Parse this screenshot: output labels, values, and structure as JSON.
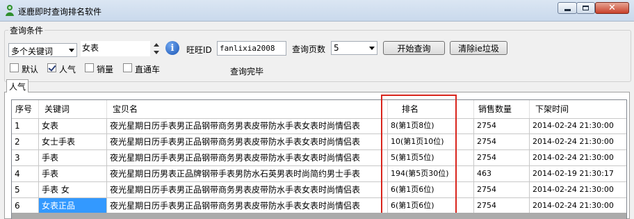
{
  "window": {
    "title": "逐鹿即时查询排名软件"
  },
  "query": {
    "group_title": "查询条件",
    "mode": "多个关键词",
    "keyword_input": "女表",
    "wangwang_label": "旺旺ID",
    "wangwang_value": "fanlixia2008",
    "pages_label": "查询页数",
    "pages_value": "5",
    "start_button": "开始查询",
    "clear_button": "清除ie垃圾",
    "status": "查询完毕",
    "options": [
      {
        "label": "默认",
        "checked": false
      },
      {
        "label": "人气",
        "checked": true
      },
      {
        "label": "销量",
        "checked": false
      },
      {
        "label": "直通车",
        "checked": false
      }
    ]
  },
  "tab": {
    "label": "人气"
  },
  "table": {
    "headers": [
      "序号",
      "关键词",
      "宝贝名",
      "排名",
      "销售数量",
      "下架时间"
    ],
    "rows": [
      [
        "1",
        "女表",
        "夜光星期日历手表男正品钢带商务男表皮带防水手表女表时尚情侣表",
        "8(第1页8位)",
        "2754",
        "2014-02-24 21:30:00"
      ],
      [
        "2",
        "女士手表",
        "夜光星期日历手表男正品钢带商务男表皮带防水手表女表时尚情侣表",
        "10(第1页10位)",
        "2754",
        "2014-02-24 21:30:00"
      ],
      [
        "3",
        "手表",
        "夜光星期日历手表男正品钢带商务男表皮带防水手表女表时尚情侣表",
        "5(第1页5位)",
        "2754",
        "2014-02-24 21:30:00"
      ],
      [
        "4",
        "手表",
        "夜光星期日历男表正品牌钢带手表男防水石英男表时尚简约男士手表",
        "194(第5页30位)",
        "463",
        "2014-02-19 21:30:17"
      ],
      [
        "5",
        "手表 女",
        "夜光星期日历手表男正品钢带商务男表皮带防水手表女表时尚情侣表",
        "6(第1页6位)",
        "2754",
        "2014-02-24 21:30:00"
      ],
      [
        "6",
        "女表正品",
        "夜光星期日历手表男正品钢带商务男表皮带防水手表女表时尚情侣表",
        "6(第1页6位)",
        "2754",
        "2014-02-24 21:30:00"
      ]
    ],
    "selected_row": 5,
    "selected_col": 1
  },
  "highlight_color": "#d9251d",
  "selection_color": "#3399ff"
}
